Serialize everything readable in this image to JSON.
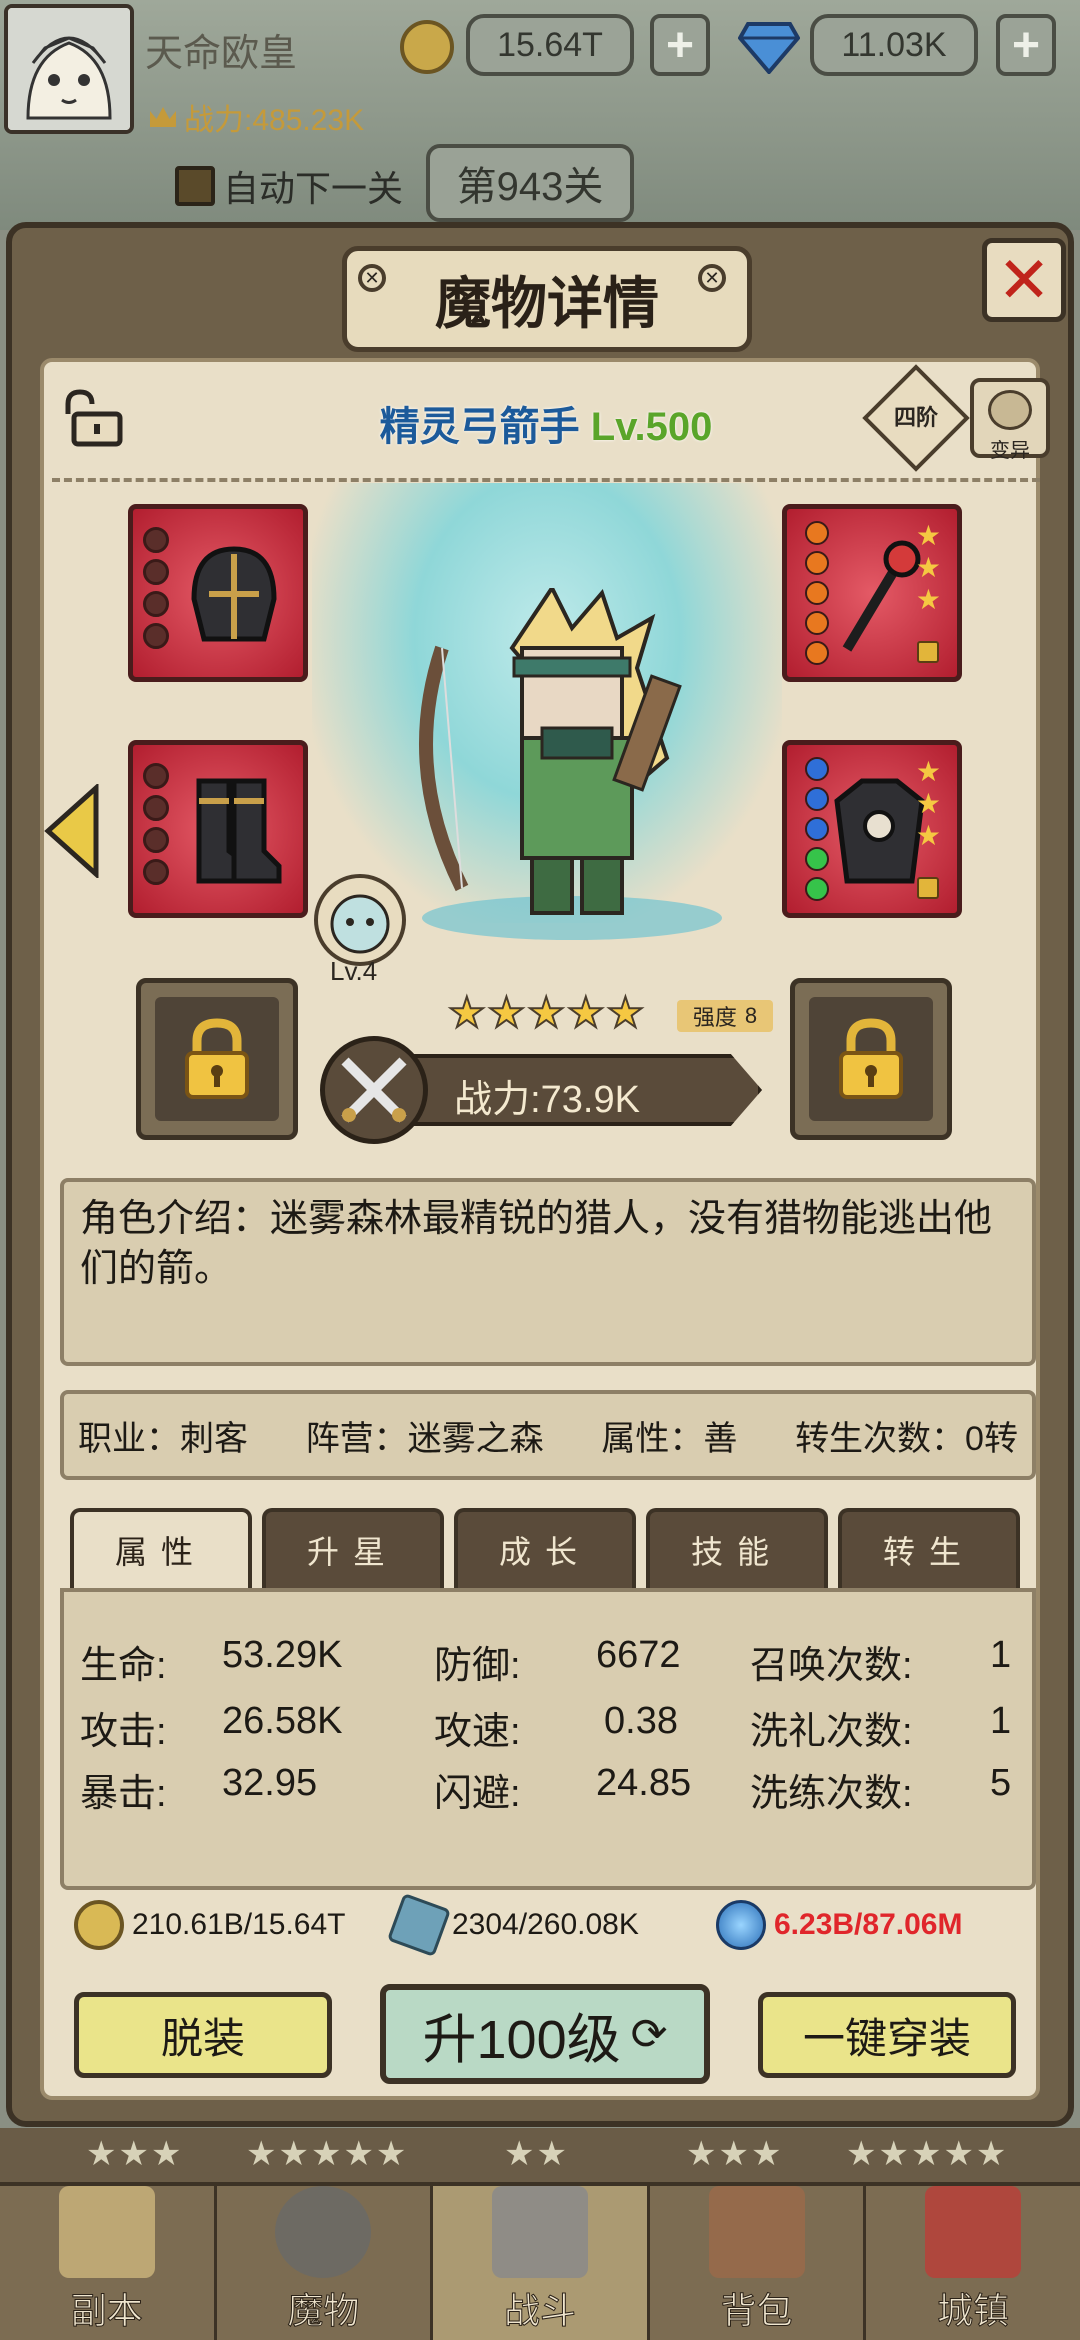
{
  "topbar": {
    "player_name": "天命欧皇",
    "power_text": "战力:485.23K",
    "gold": "15.64T",
    "diamond": "11.03K",
    "auto_next_label": "自动下一关",
    "stage_label": "第943关"
  },
  "panel": {
    "title": "魔物详情",
    "monster_name": "精灵弓箭手",
    "monster_level": "Lv.500",
    "tier_label": "四阶",
    "mutate_label": "变异",
    "pet_level": "Lv.4",
    "star_count": 5,
    "strength_label": "强度",
    "strength_value": "8",
    "power_label": "战力:73.9K",
    "intro_text": "角色介绍：迷雾森林最精锐的猎人，没有猎物能逃出他们的箭。",
    "info": {
      "job": "职业：刺客",
      "camp": "阵营：迷雾之森",
      "attr": "属性：善",
      "rebirth": "转生次数：0转"
    },
    "tabs": [
      "属性",
      "升星",
      "成长",
      "技能",
      "转生"
    ],
    "stats": {
      "hp_label": "生命:",
      "hp": "53.29K",
      "def_label": "防御:",
      "def": "6672",
      "summon_label": "召唤次数:",
      "summon": "1",
      "atk_label": "攻击:",
      "atk": "26.58K",
      "spd_label": "攻速:",
      "spd": "0.38",
      "baptism_label": "洗礼次数:",
      "baptism": "1",
      "crit_label": "暴击:",
      "crit": "32.95",
      "dodge_label": "闪避:",
      "dodge": "24.85",
      "refine_label": "洗练次数:",
      "refine": "5"
    },
    "resources": {
      "gold": "210.61B/15.64T",
      "stone": "2304/260.08K",
      "orb": "6.23B/87.06M"
    },
    "buttons": {
      "unequip": "脱装",
      "level_up": "升100级",
      "equip_all": "一键穿装"
    }
  },
  "nav": {
    "items": [
      "副本",
      "魔物",
      "战斗",
      "背包",
      "城镇"
    ],
    "active_index": 2
  },
  "colors": {
    "accent_red": "#c0241b",
    "equip_red": "#b21e2f",
    "resource_warning": "#e0262b",
    "name_blue": "#1c5a9a",
    "level_green": "#5aa52a"
  }
}
